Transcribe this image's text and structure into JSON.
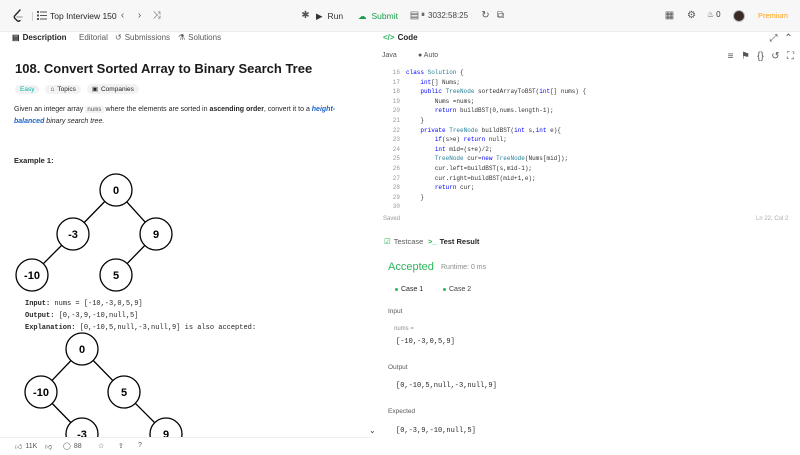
{
  "topbar": {
    "title": "Top Interview 150",
    "run_label": "Run",
    "submit_label": "Submit",
    "timer": "3032:58:25",
    "streak": "0",
    "premium_label": "Premium"
  },
  "left_tabs": [
    "Description",
    "Editorial",
    "Submissions",
    "Solutions"
  ],
  "question": {
    "title": "108. Convert Sorted Array to Binary Search Tree",
    "difficulty": "Easy",
    "topics_label": "Topics",
    "companies_label": "Companies",
    "desc_1": "Given an integer array ",
    "desc_code": "nums",
    "desc_2": " where the elements are sorted in ",
    "desc_bold": "ascending order",
    "desc_3": ", convert it to a ",
    "desc_link": "height-balanced",
    "desc_4": " binary search tree."
  },
  "example": {
    "title": "Example 1:",
    "tree1": [
      "0",
      "-3",
      "9",
      "-10",
      "5"
    ],
    "input_label": "Input:",
    "input_value": "nums = [-10,-3,0,5,9]",
    "output_label": "Output:",
    "output_value": "[0,-3,9,-10,null,5]",
    "explanation_label": "Explanation:",
    "explanation_value": "[0,-10,5,null,-3,null,9] is also accepted:",
    "tree2": [
      "0",
      "-10",
      "5",
      "-3",
      "9"
    ]
  },
  "footer_left": {
    "likes": "11K",
    "comments": "88"
  },
  "code": {
    "title": "Code",
    "lang": "Java",
    "mode": "Auto",
    "line_numbers": [
      "16",
      "17",
      "18",
      "19",
      "20",
      "21",
      "22",
      "23",
      "24",
      "25",
      "26",
      "27",
      "28",
      "29",
      "30"
    ],
    "saved": "Saved",
    "cursor": "Ln 22, Col 2"
  },
  "result": {
    "tab_testcase": "Testcase",
    "tab_result": "Test Result",
    "status": "Accepted",
    "runtime": "Runtime: 0 ms",
    "cases": [
      "Case 1",
      "Case 2"
    ],
    "input_label": "Input",
    "input_param": "nums =",
    "input_value": "[-10,-3,0,5,9]",
    "output_label": "Output",
    "output_value": "[0,-10,5,null,-3,null,9]",
    "expected_label": "Expected",
    "expected_value": "[0,-3,9,-10,null,5]"
  }
}
